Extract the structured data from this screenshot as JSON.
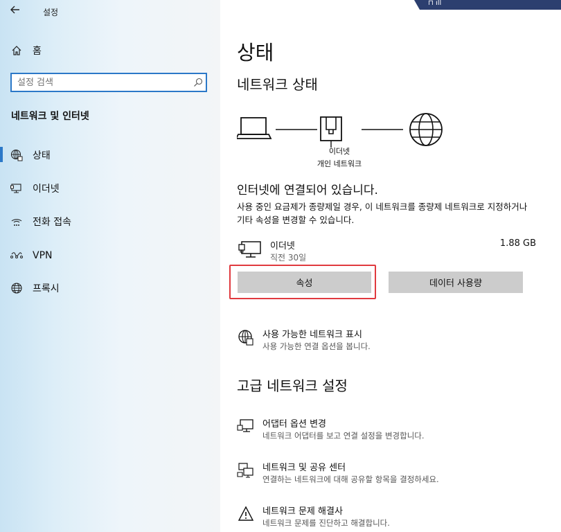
{
  "sidebar": {
    "app_title": "설정",
    "home_label": "홈",
    "search_placeholder": "설정 검색",
    "section_title": "네트워크 및 인터넷",
    "items": [
      {
        "label": "상태",
        "icon": "globe-network-icon"
      },
      {
        "label": "이더넷",
        "icon": "ethernet-monitor-icon"
      },
      {
        "label": "전화 접속",
        "icon": "dialup-icon"
      },
      {
        "label": "VPN",
        "icon": "vpn-icon"
      },
      {
        "label": "프록시",
        "icon": "globe-icon"
      }
    ]
  },
  "main": {
    "title": "상태",
    "network_status_heading": "네트워크 상태",
    "diagram": {
      "adapter_label": "이더넷",
      "network_label": "개인 네트워크"
    },
    "connected_heading": "인터넷에 연결되어 있습니다.",
    "connected_desc": "사용 중인 요금제가 종량제일 경우, 이 네트워크를 종량제 네트워크로 지정하거나 기타 속성을 변경할 수 있습니다.",
    "connection": {
      "name": "이더넷",
      "time": "직전 30일",
      "usage": "1.88 GB"
    },
    "buttons": {
      "properties": "속성",
      "data_usage": "데이터 사용량"
    },
    "available_networks": {
      "title": "사용 가능한 네트워크 표시",
      "desc": "사용 가능한 연결 옵션을 봅니다."
    },
    "advanced_heading": "고급 네트워크 설정",
    "advanced_items": [
      {
        "title": "어댑터 옵션 변경",
        "desc": "네트워크 어댑터를 보고 연결 설정을 변경합니다.",
        "icon": "adapter-icon"
      },
      {
        "title": "네트워크 및 공유 센터",
        "desc": "연결하는 네트워크에 대해 공유할 항목을 결정하세요.",
        "icon": "sharing-center-icon"
      },
      {
        "title": "네트워크 문제 해결사",
        "desc": "네트워크 문제를 진단하고 해결합니다.",
        "icon": "warning-icon"
      }
    ]
  },
  "colors": {
    "accent": "#2b78c8",
    "highlight": "#e0393e",
    "button_bg": "#cccccc"
  }
}
